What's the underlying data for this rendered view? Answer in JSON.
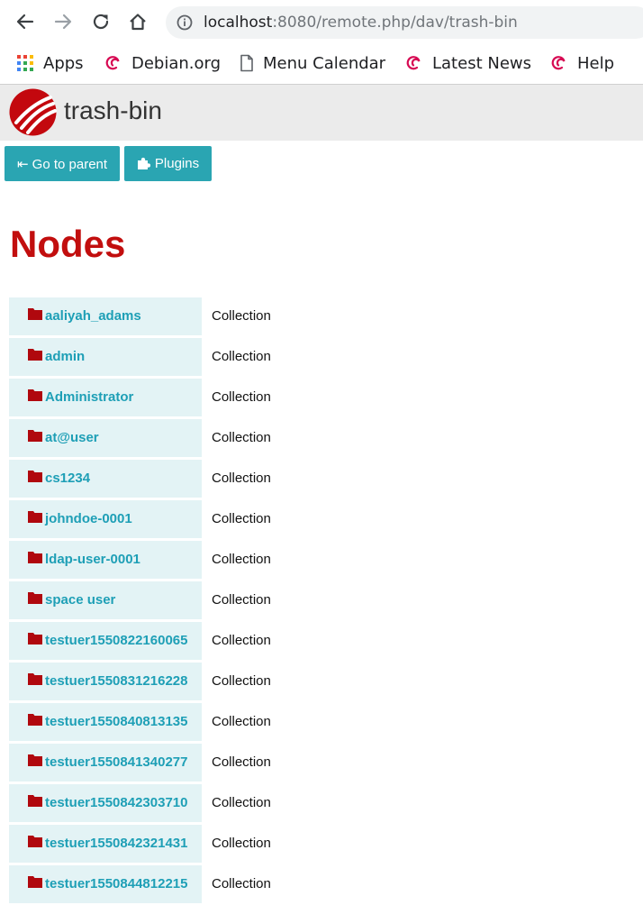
{
  "browser": {
    "url_host": "localhost",
    "url_rest": ":8080/remote.php/dav/trash-bin",
    "bookmarks": [
      {
        "label": "Apps",
        "icon": "apps-grid-icon"
      },
      {
        "label": "Debian.org",
        "icon": "debian-swirl-icon"
      },
      {
        "label": "Menu Calendar",
        "icon": "page-icon"
      },
      {
        "label": "Latest News",
        "icon": "debian-swirl-icon"
      },
      {
        "label": "Help",
        "icon": "debian-swirl-icon"
      }
    ]
  },
  "header": {
    "title": "trash-bin"
  },
  "buttons": {
    "parent": "⇤ Go to parent",
    "plugins": "Plugins"
  },
  "heading": "Nodes",
  "nodes": [
    {
      "name": "aaliyah_adams",
      "type": "Collection"
    },
    {
      "name": "admin",
      "type": "Collection"
    },
    {
      "name": "Administrator",
      "type": "Collection"
    },
    {
      "name": "at@user",
      "type": "Collection"
    },
    {
      "name": "cs1234",
      "type": "Collection"
    },
    {
      "name": "johndoe-0001",
      "type": "Collection"
    },
    {
      "name": "ldap-user-0001",
      "type": "Collection"
    },
    {
      "name": "space user",
      "type": "Collection"
    },
    {
      "name": "testuer1550822160065",
      "type": "Collection"
    },
    {
      "name": "testuer1550831216228",
      "type": "Collection"
    },
    {
      "name": "testuer1550840813135",
      "type": "Collection"
    },
    {
      "name": "testuer1550841340277",
      "type": "Collection"
    },
    {
      "name": "testuer1550842303710",
      "type": "Collection"
    },
    {
      "name": "testuer1550842321431",
      "type": "Collection"
    },
    {
      "name": "testuer1550844812215",
      "type": "Collection"
    }
  ],
  "colors": {
    "accent_button": "#2aa5b2",
    "heading_red": "#c20e0e",
    "link_teal": "#1e9fb6",
    "row_bg": "#e3f3f5",
    "folder_red": "#b0080e"
  }
}
